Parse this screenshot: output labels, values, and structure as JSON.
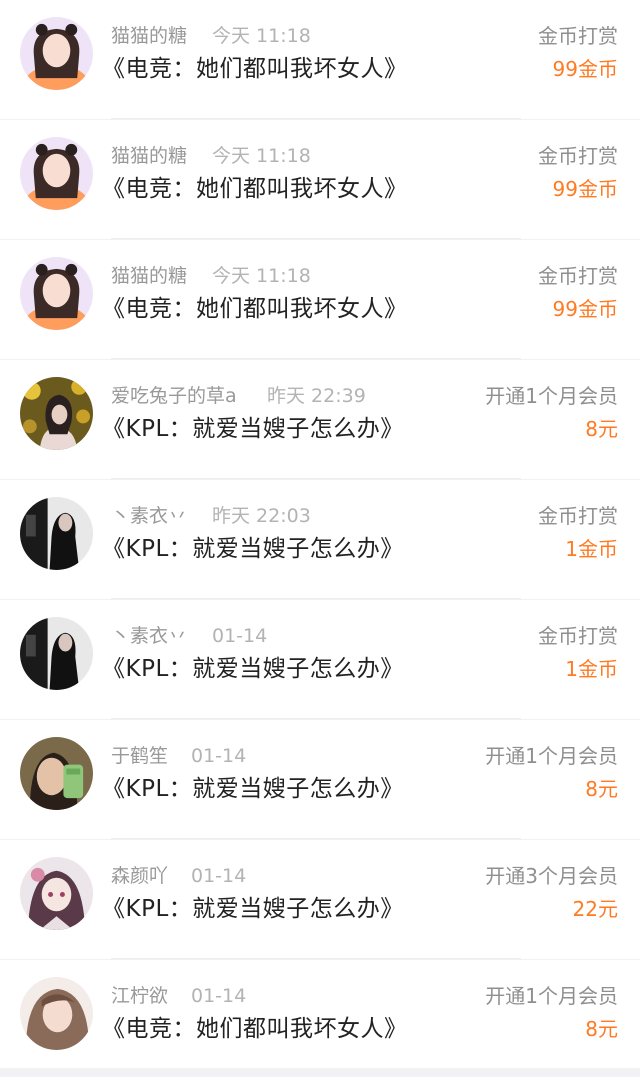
{
  "records": [
    {
      "user": "猫猫的糖",
      "time": "今天 11:18",
      "book": "《电竞：她们都叫我坏女人》",
      "type": "金币打赏",
      "amount": "99金币",
      "avatar": "avatar-girl-headband"
    },
    {
      "user": "猫猫的糖",
      "time": "今天 11:18",
      "book": "《电竞：她们都叫我坏女人》",
      "type": "金币打赏",
      "amount": "99金币",
      "avatar": "avatar-girl-headband"
    },
    {
      "user": "猫猫的糖",
      "time": "今天 11:18",
      "book": "《电竞：她们都叫我坏女人》",
      "type": "金币打赏",
      "amount": "99金币",
      "avatar": "avatar-girl-headband"
    },
    {
      "user": "爱吃兔子的草a",
      "time": "昨天 22:39",
      "book": "《KPL：就爱当嫂子怎么办》",
      "type": "开通1个月会员",
      "amount": "8元",
      "avatar": "avatar-girl-yellow-flowers"
    },
    {
      "user": "丶素衣丷",
      "time": "昨天 22:03",
      "book": "《KPL：就爱当嫂子怎么办》",
      "type": "金币打赏",
      "amount": "1金币",
      "avatar": "avatar-silhouette-dark"
    },
    {
      "user": "丶素衣丷",
      "time": "01-14",
      "book": "《KPL：就爱当嫂子怎么办》",
      "type": "金币打赏",
      "amount": "1金币",
      "avatar": "avatar-silhouette-dark"
    },
    {
      "user": "于鹤笙",
      "time": "01-14",
      "book": "《KPL：就爱当嫂子怎么办》",
      "type": "开通1个月会员",
      "amount": "8元",
      "avatar": "avatar-girl-green-phone"
    },
    {
      "user": "森颜吖",
      "time": "01-14",
      "book": "《KPL：就爱当嫂子怎么办》",
      "type": "开通3个月会员",
      "amount": "22元",
      "avatar": "avatar-anime-girl"
    },
    {
      "user": "江柠欲",
      "time": "01-14",
      "book": "《电竞：她们都叫我坏女人》",
      "type": "开通1个月会员",
      "amount": "8元",
      "avatar": "avatar-girl-light"
    }
  ],
  "colors": {
    "background": "#f2f2f4",
    "row": "#ffffff",
    "amount": "#ff7a22",
    "name": "#999999",
    "title": "#222222"
  }
}
